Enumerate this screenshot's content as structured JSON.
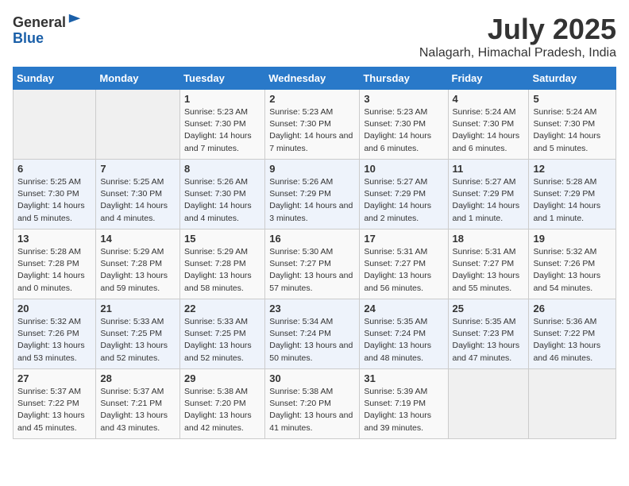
{
  "header": {
    "logo_line1": "General",
    "logo_line2": "Blue",
    "title": "July 2025",
    "subtitle": "Nalagarh, Himachal Pradesh, India"
  },
  "calendar": {
    "days_of_week": [
      "Sunday",
      "Monday",
      "Tuesday",
      "Wednesday",
      "Thursday",
      "Friday",
      "Saturday"
    ],
    "weeks": [
      [
        {
          "day": "",
          "info": ""
        },
        {
          "day": "",
          "info": ""
        },
        {
          "day": "1",
          "info": "Sunrise: 5:23 AM\nSunset: 7:30 PM\nDaylight: 14 hours and 7 minutes."
        },
        {
          "day": "2",
          "info": "Sunrise: 5:23 AM\nSunset: 7:30 PM\nDaylight: 14 hours and 7 minutes."
        },
        {
          "day": "3",
          "info": "Sunrise: 5:23 AM\nSunset: 7:30 PM\nDaylight: 14 hours and 6 minutes."
        },
        {
          "day": "4",
          "info": "Sunrise: 5:24 AM\nSunset: 7:30 PM\nDaylight: 14 hours and 6 minutes."
        },
        {
          "day": "5",
          "info": "Sunrise: 5:24 AM\nSunset: 7:30 PM\nDaylight: 14 hours and 5 minutes."
        }
      ],
      [
        {
          "day": "6",
          "info": "Sunrise: 5:25 AM\nSunset: 7:30 PM\nDaylight: 14 hours and 5 minutes."
        },
        {
          "day": "7",
          "info": "Sunrise: 5:25 AM\nSunset: 7:30 PM\nDaylight: 14 hours and 4 minutes."
        },
        {
          "day": "8",
          "info": "Sunrise: 5:26 AM\nSunset: 7:30 PM\nDaylight: 14 hours and 4 minutes."
        },
        {
          "day": "9",
          "info": "Sunrise: 5:26 AM\nSunset: 7:29 PM\nDaylight: 14 hours and 3 minutes."
        },
        {
          "day": "10",
          "info": "Sunrise: 5:27 AM\nSunset: 7:29 PM\nDaylight: 14 hours and 2 minutes."
        },
        {
          "day": "11",
          "info": "Sunrise: 5:27 AM\nSunset: 7:29 PM\nDaylight: 14 hours and 1 minute."
        },
        {
          "day": "12",
          "info": "Sunrise: 5:28 AM\nSunset: 7:29 PM\nDaylight: 14 hours and 1 minute."
        }
      ],
      [
        {
          "day": "13",
          "info": "Sunrise: 5:28 AM\nSunset: 7:28 PM\nDaylight: 14 hours and 0 minutes."
        },
        {
          "day": "14",
          "info": "Sunrise: 5:29 AM\nSunset: 7:28 PM\nDaylight: 13 hours and 59 minutes."
        },
        {
          "day": "15",
          "info": "Sunrise: 5:29 AM\nSunset: 7:28 PM\nDaylight: 13 hours and 58 minutes."
        },
        {
          "day": "16",
          "info": "Sunrise: 5:30 AM\nSunset: 7:27 PM\nDaylight: 13 hours and 57 minutes."
        },
        {
          "day": "17",
          "info": "Sunrise: 5:31 AM\nSunset: 7:27 PM\nDaylight: 13 hours and 56 minutes."
        },
        {
          "day": "18",
          "info": "Sunrise: 5:31 AM\nSunset: 7:27 PM\nDaylight: 13 hours and 55 minutes."
        },
        {
          "day": "19",
          "info": "Sunrise: 5:32 AM\nSunset: 7:26 PM\nDaylight: 13 hours and 54 minutes."
        }
      ],
      [
        {
          "day": "20",
          "info": "Sunrise: 5:32 AM\nSunset: 7:26 PM\nDaylight: 13 hours and 53 minutes."
        },
        {
          "day": "21",
          "info": "Sunrise: 5:33 AM\nSunset: 7:25 PM\nDaylight: 13 hours and 52 minutes."
        },
        {
          "day": "22",
          "info": "Sunrise: 5:33 AM\nSunset: 7:25 PM\nDaylight: 13 hours and 52 minutes."
        },
        {
          "day": "23",
          "info": "Sunrise: 5:34 AM\nSunset: 7:24 PM\nDaylight: 13 hours and 50 minutes."
        },
        {
          "day": "24",
          "info": "Sunrise: 5:35 AM\nSunset: 7:24 PM\nDaylight: 13 hours and 48 minutes."
        },
        {
          "day": "25",
          "info": "Sunrise: 5:35 AM\nSunset: 7:23 PM\nDaylight: 13 hours and 47 minutes."
        },
        {
          "day": "26",
          "info": "Sunrise: 5:36 AM\nSunset: 7:22 PM\nDaylight: 13 hours and 46 minutes."
        }
      ],
      [
        {
          "day": "27",
          "info": "Sunrise: 5:37 AM\nSunset: 7:22 PM\nDaylight: 13 hours and 45 minutes."
        },
        {
          "day": "28",
          "info": "Sunrise: 5:37 AM\nSunset: 7:21 PM\nDaylight: 13 hours and 43 minutes."
        },
        {
          "day": "29",
          "info": "Sunrise: 5:38 AM\nSunset: 7:20 PM\nDaylight: 13 hours and 42 minutes."
        },
        {
          "day": "30",
          "info": "Sunrise: 5:38 AM\nSunset: 7:20 PM\nDaylight: 13 hours and 41 minutes."
        },
        {
          "day": "31",
          "info": "Sunrise: 5:39 AM\nSunset: 7:19 PM\nDaylight: 13 hours and 39 minutes."
        },
        {
          "day": "",
          "info": ""
        },
        {
          "day": "",
          "info": ""
        }
      ]
    ]
  }
}
